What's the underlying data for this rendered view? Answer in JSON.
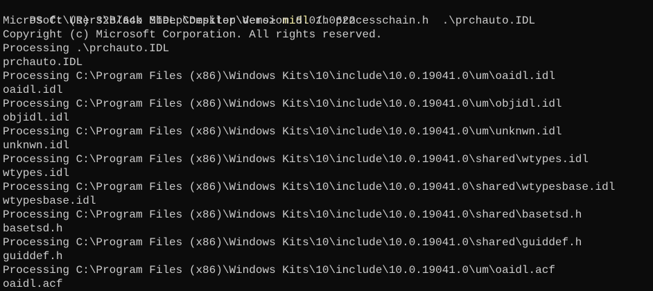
{
  "terminal": {
    "colors": {
      "background": "#0c0c0c",
      "foreground": "#cccccc",
      "command": "#f9f1a5"
    },
    "prompt": "PS C:\\Users\\Black Sheep\\Desktop\\demo> ",
    "command": "midl",
    "command_args": " /h processchain.h  .\\prchauto.IDL",
    "lines": [
      "Microsoft (R) 32b/64b MIDL Compiler Version 8.01.0622",
      "Copyright (c) Microsoft Corporation. All rights reserved.",
      "Processing .\\prchauto.IDL",
      "prchauto.IDL",
      "Processing C:\\Program Files (x86)\\Windows Kits\\10\\include\\10.0.19041.0\\um\\oaidl.idl",
      "oaidl.idl",
      "Processing C:\\Program Files (x86)\\Windows Kits\\10\\include\\10.0.19041.0\\um\\objidl.idl",
      "objidl.idl",
      "Processing C:\\Program Files (x86)\\Windows Kits\\10\\include\\10.0.19041.0\\um\\unknwn.idl",
      "unknwn.idl",
      "Processing C:\\Program Files (x86)\\Windows Kits\\10\\include\\10.0.19041.0\\shared\\wtypes.idl",
      "wtypes.idl",
      "Processing C:\\Program Files (x86)\\Windows Kits\\10\\include\\10.0.19041.0\\shared\\wtypesbase.idl",
      "wtypesbase.idl",
      "Processing C:\\Program Files (x86)\\Windows Kits\\10\\include\\10.0.19041.0\\shared\\basetsd.h",
      "basetsd.h",
      "Processing C:\\Program Files (x86)\\Windows Kits\\10\\include\\10.0.19041.0\\shared\\guiddef.h",
      "guiddef.h",
      "Processing C:\\Program Files (x86)\\Windows Kits\\10\\include\\10.0.19041.0\\um\\oaidl.acf",
      "oaidl.acf"
    ]
  }
}
